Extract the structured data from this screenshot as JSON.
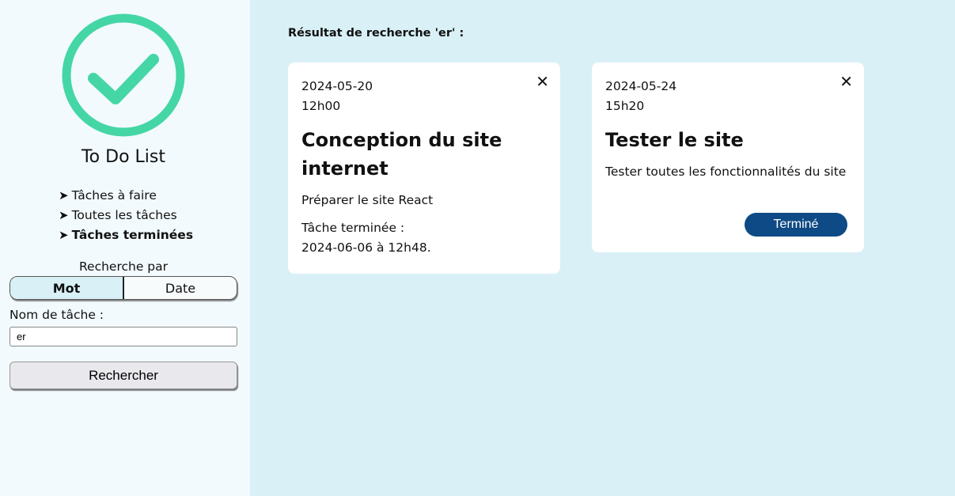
{
  "sidebar": {
    "app_title": "To Do List",
    "accent_color": "#45d6a6",
    "nav": [
      {
        "label": "Tâches à faire",
        "active": false
      },
      {
        "label": "Toutes les tâches",
        "active": false
      },
      {
        "label": "Tâches terminées",
        "active": true
      }
    ],
    "search": {
      "by_label": "Recherche par",
      "options": [
        {
          "label": "Mot",
          "selected": true
        },
        {
          "label": "Date",
          "selected": false
        }
      ],
      "field_label": "Nom de tâche :",
      "input_value": "er",
      "button_label": "Rechercher"
    }
  },
  "main": {
    "results_title": "Résultat de recherche 'er' :",
    "cards": [
      {
        "date": "2024-05-20",
        "time": "12h00",
        "title": "Conception du site internet",
        "description": "Préparer le site React",
        "done_label": "Tâche terminée :",
        "done_value": "2024-06-06 à 12h48.",
        "close_icon": "close-icon"
      },
      {
        "date": "2024-05-24",
        "time": "15h20",
        "title": "Tester le site",
        "description": "Tester toutes les fonctionnalités du site",
        "button_label": "Terminé",
        "button_color": "#0e4a85",
        "close_icon": "close-icon"
      }
    ]
  }
}
